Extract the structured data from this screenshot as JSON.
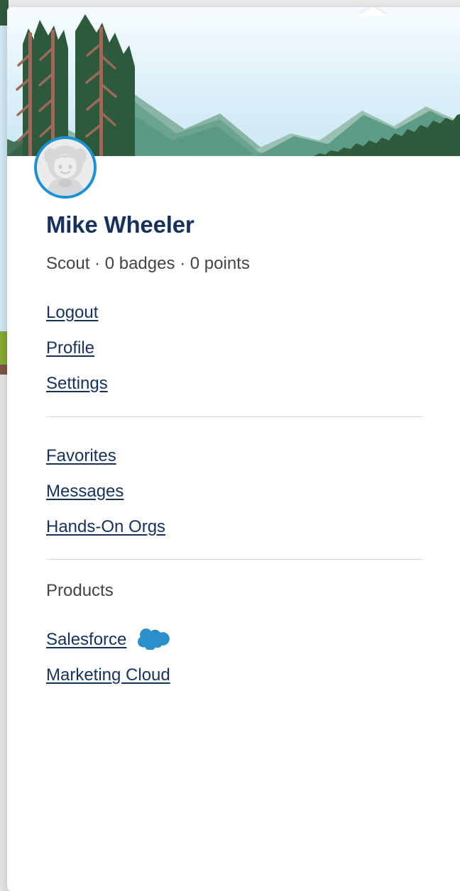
{
  "popover": {
    "name": "profile-menu-popover",
    "banner": {
      "icon": "mountain-landscape-banner",
      "sky_top_color": "#f7fcfe",
      "sky_bottom_color": "#cbe7f5",
      "mountain_far_color": "#7fae9e",
      "mountain_mid_color": "#5f9c88",
      "mountain_near_color": "#4f8f7c",
      "forest_color": "#2f5a3c",
      "tree_trunk_color": "#9c6a5a"
    },
    "avatar": {
      "icon": "astro-placeholder-avatar",
      "ring_color": "#1b92d6",
      "fill_color": "#d7d8d9"
    },
    "user": {
      "display_name": "Mike Wheeler",
      "meta": "Scout · 0 badges · 0 points",
      "rank": "Scout",
      "badges": "0 badges",
      "points": "0 points"
    },
    "account_links": [
      {
        "label": "Logout",
        "name": "logout-link"
      },
      {
        "label": "Profile",
        "name": "profile-link"
      },
      {
        "label": "Settings",
        "name": "settings-link"
      }
    ],
    "activity_links": [
      {
        "label": "Favorites",
        "name": "favorites-link"
      },
      {
        "label": "Messages",
        "name": "messages-link"
      },
      {
        "label": "Hands-On Orgs",
        "name": "hands-on-orgs-link"
      }
    ],
    "products": {
      "heading": "Products",
      "items": [
        {
          "label": "Salesforce",
          "name": "salesforce-link",
          "icon": "salesforce-cloud-icon",
          "icon_color": "#2a8fca"
        },
        {
          "label": "Marketing Cloud",
          "name": "marketing-cloud-link",
          "icon": null
        }
      ]
    },
    "colors": {
      "link": "#16325c",
      "heading": "#16325c",
      "muted_text": "#444444",
      "divider": "#dddbda",
      "card_bg": "#ffffff",
      "accent_blue": "#1b92d6"
    }
  }
}
